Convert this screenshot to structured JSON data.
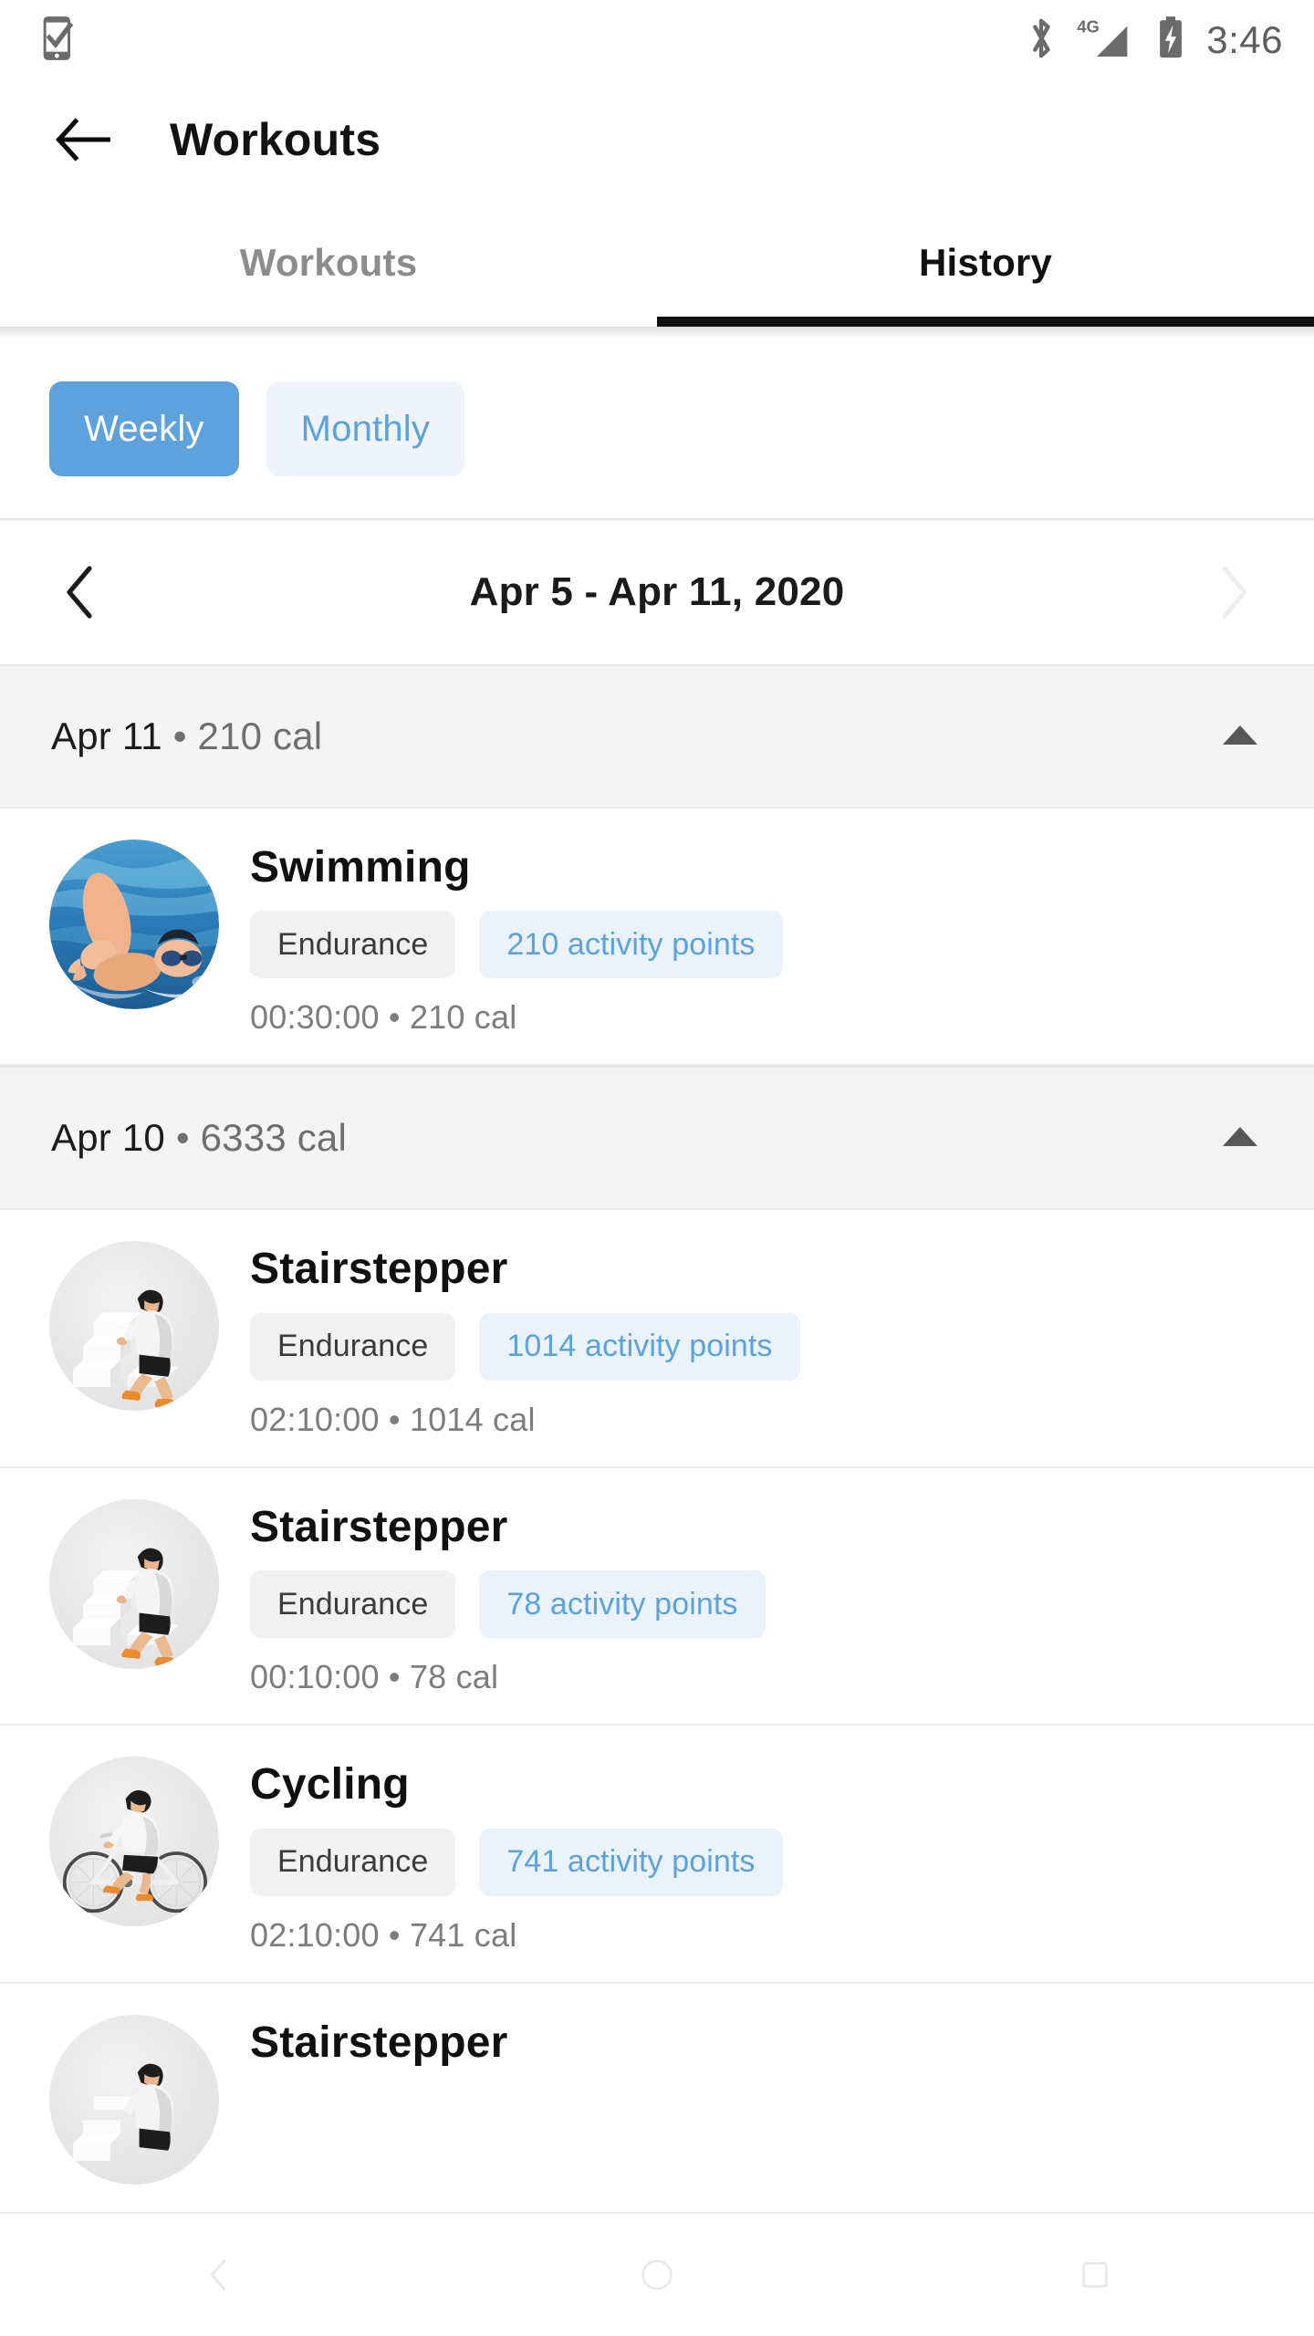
{
  "status_bar": {
    "left_icon": "phone-check-icon",
    "bluetooth_icon": "bluetooth-icon",
    "network_label": "4G",
    "signal_icon": "signal-icon",
    "battery_icon": "battery-charging-icon",
    "time": "3:46"
  },
  "app_bar": {
    "back_icon": "back-arrow-icon",
    "title": "Workouts"
  },
  "tabs": {
    "items": [
      {
        "label": "Workouts",
        "active": false
      },
      {
        "label": "History",
        "active": true
      }
    ]
  },
  "period_toggle": {
    "weekly_label": "Weekly",
    "monthly_label": "Monthly",
    "selected": "Weekly",
    "selected_bg": "#5da2dc",
    "unselected_bg": "#eef4fa",
    "unselected_fg": "#5da2dc"
  },
  "date_nav": {
    "prev_icon": "chevron-left-icon",
    "next_icon": "chevron-right-icon",
    "range_label": "Apr 5 - Apr 11, 2020",
    "prev_enabled": true,
    "next_enabled": false
  },
  "history": {
    "groups": [
      {
        "date": "Apr 11",
        "separator": "•",
        "calories": "210 cal",
        "collapse_icon": "triangle-up-icon",
        "workouts": [
          {
            "name": "Swimming",
            "icon": "swimming-photo",
            "type_chip": "Endurance",
            "points_chip": "210 activity points",
            "meta": "00:30:00 • 210 cal"
          }
        ]
      },
      {
        "date": "Apr 10",
        "separator": "•",
        "calories": "6333 cal",
        "collapse_icon": "triangle-up-icon",
        "workouts": [
          {
            "name": "Stairstepper",
            "icon": "stairstepper-illustration",
            "type_chip": "Endurance",
            "points_chip": "1014 activity points",
            "meta": "02:10:00 • 1014 cal"
          },
          {
            "name": "Stairstepper",
            "icon": "stairstepper-illustration",
            "type_chip": "Endurance",
            "points_chip": "78 activity points",
            "meta": "00:10:00 • 78 cal"
          },
          {
            "name": "Cycling",
            "icon": "cycling-illustration",
            "type_chip": "Endurance",
            "points_chip": "741 activity points",
            "meta": "02:10:00 • 741 cal"
          },
          {
            "name": "Stairstepper",
            "icon": "stairstepper-illustration",
            "type_chip": "",
            "points_chip": "",
            "meta": ""
          }
        ]
      }
    ]
  },
  "nav_hints": {
    "back_icon": "nav-back-icon",
    "home_icon": "nav-home-icon",
    "recents_icon": "nav-recents-icon"
  },
  "colors": {
    "accent": "#5da2dc",
    "chip_gray": "#f1f1f1",
    "chip_blue": "#eaf2fb",
    "group_header": "#f4f4f4",
    "text_primary": "#101010",
    "text_secondary": "#7d7d7d"
  }
}
